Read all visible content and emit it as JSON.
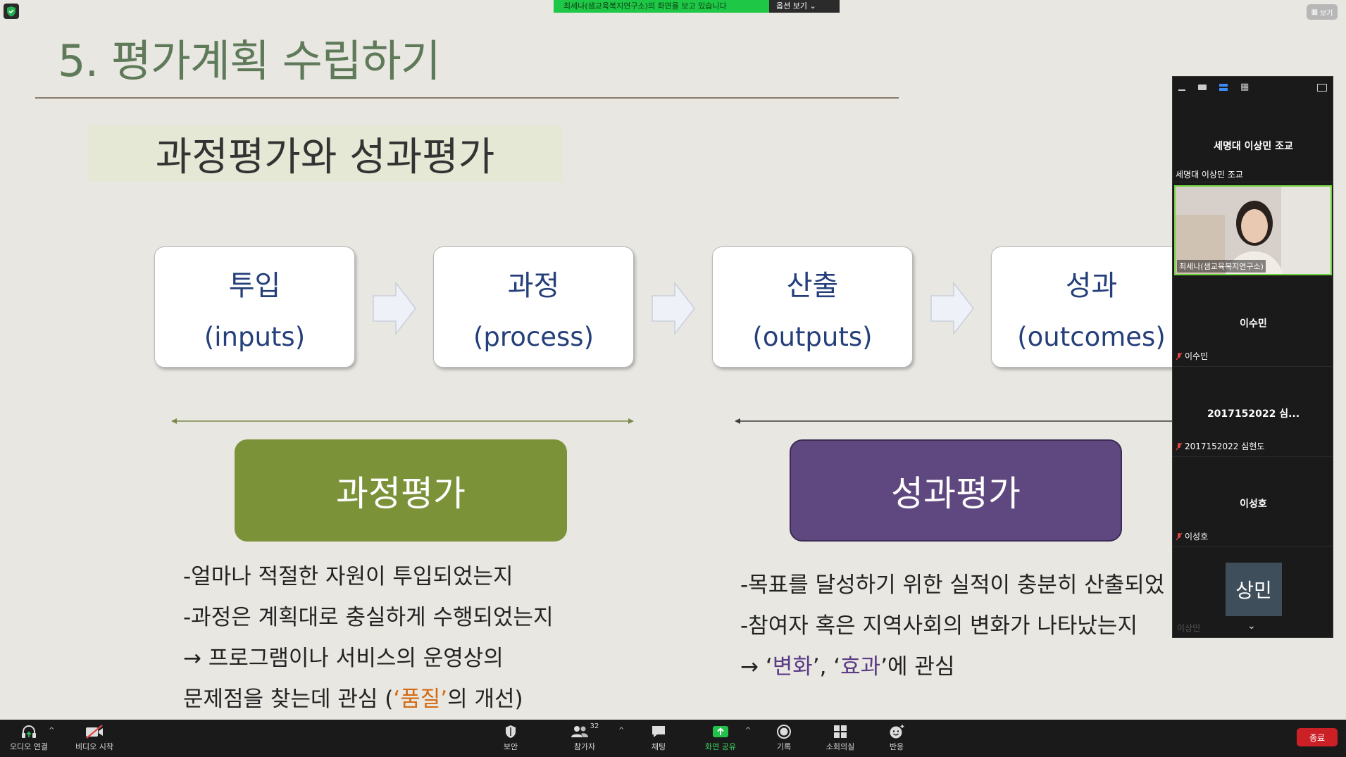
{
  "slide": {
    "title": "5. 평가계획 수립하기",
    "subtitle": "과정평가와 성과평가",
    "stages": [
      {
        "kr": "투입",
        "en": "(inputs)"
      },
      {
        "kr": "과정",
        "en": "(process)"
      },
      {
        "kr": "산출",
        "en": "(outputs)"
      },
      {
        "kr": "성과",
        "en": "(outcomes)"
      }
    ],
    "process_eval": {
      "label": "과정평가",
      "color": "#7b9239",
      "line1": "-얼마나 적절한 자원이 투입되었는지",
      "line2": "-과정은 계획대로 충실하게 수행되었는지",
      "line3": "→ 프로그램이나 서비스의 운영상의",
      "line4_pre": "문제점을 찾는데 관심 (",
      "line4_hl": "‘품질’",
      "line4_post": "의 개선)"
    },
    "outcome_eval": {
      "label": "성과평가",
      "color": "#5f4880",
      "line1": "-목표를 달성하기 위한 실적이 충분히 산출되었",
      "line2": "-참여자 혹은 지역사회의 변화가 나타났는지",
      "line3_pre": "→ ‘",
      "line3_hl1": "변화",
      "line3_mid": "’, ‘",
      "line3_hl2": "효과",
      "line3_post": "’에 관심"
    }
  },
  "overlay": {
    "share_banner": "최세나(샘교육복지연구소)의 화면을 보고 있습니다",
    "options_label": "옵션 보기 ⌄",
    "view_label": "보기"
  },
  "participants": {
    "tiles": [
      {
        "center": "세명대 이상민 조교",
        "tag": "세명대 이상민 조교"
      },
      {
        "tag": "최세나(샘교육복지연구소)"
      },
      {
        "center": "이수민",
        "tag": "이수민"
      },
      {
        "center": "2017152022 심...",
        "tag": "2017152022 심현도"
      },
      {
        "center": "이성호",
        "tag": "이성호"
      },
      {
        "avatar": "상민",
        "tag": "이상민"
      }
    ]
  },
  "toolbar": {
    "audio": "오디오 연결",
    "video": "비디오 시작",
    "security": "보안",
    "participants": "참가자",
    "participants_count": "32",
    "chat": "채팅",
    "share": "화면 공유",
    "record": "기록",
    "breakout": "소회의실",
    "reactions": "반응",
    "end": "종료"
  }
}
